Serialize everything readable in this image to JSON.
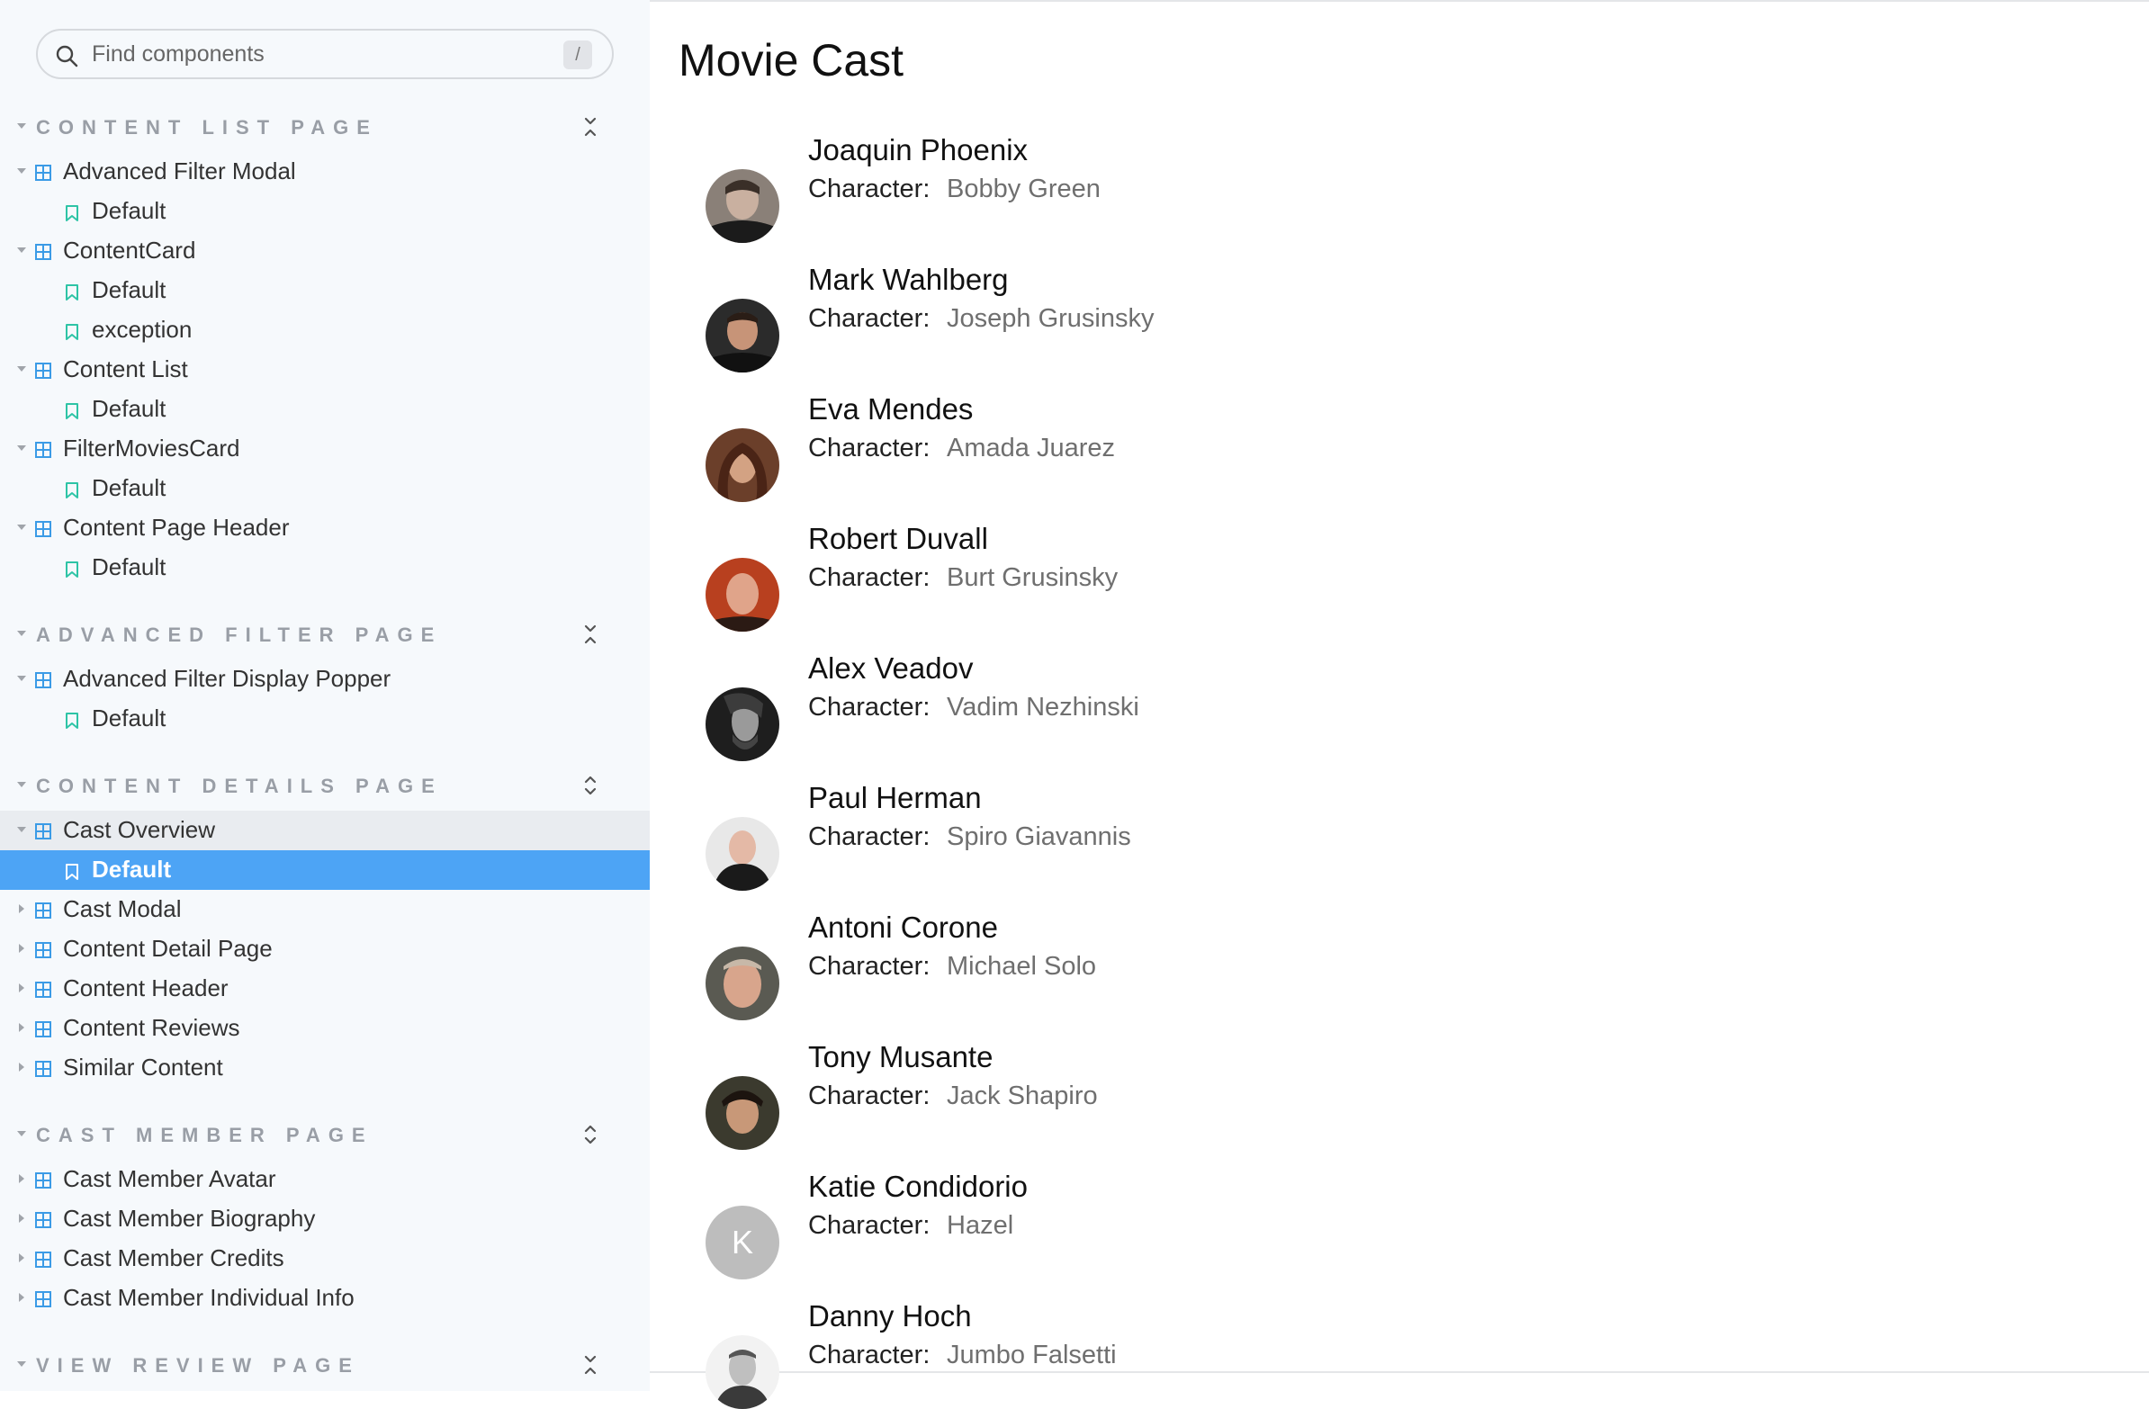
{
  "sidebar": {
    "search": {
      "placeholder": "Find components",
      "shortcut": "/"
    },
    "sections": [
      {
        "title": "CONTENT LIST PAGE",
        "components": [
          {
            "name": "Advanced Filter Modal",
            "stories": [
              "Default"
            ]
          },
          {
            "name": "ContentCard",
            "stories": [
              "Default",
              "exception"
            ]
          },
          {
            "name": "Content List",
            "stories": [
              "Default"
            ]
          },
          {
            "name": "FilterMoviesCard",
            "stories": [
              "Default"
            ]
          },
          {
            "name": "Content Page Header",
            "stories": [
              "Default"
            ]
          }
        ]
      },
      {
        "title": "ADVANCED FILTER PAGE",
        "components": [
          {
            "name": "Advanced Filter Display Popper",
            "stories": [
              "Default"
            ]
          }
        ]
      },
      {
        "title": "CONTENT DETAILS PAGE",
        "components": [
          {
            "name": "Cast Overview",
            "stories": [
              "Default"
            ]
          },
          {
            "name": "Cast Modal"
          },
          {
            "name": "Content Detail Page"
          },
          {
            "name": "Content Header"
          },
          {
            "name": "Content Reviews"
          },
          {
            "name": "Similar Content"
          }
        ]
      },
      {
        "title": "CAST MEMBER PAGE",
        "components": [
          {
            "name": "Cast Member Avatar"
          },
          {
            "name": "Cast Member Biography"
          },
          {
            "name": "Cast Member Credits"
          },
          {
            "name": "Cast Member Individual Info"
          }
        ]
      },
      {
        "title": "VIEW REVIEW PAGE"
      }
    ],
    "selected_story": "Default"
  },
  "main": {
    "title": "Movie Cast",
    "character_label": "Character:",
    "cast": [
      {
        "actor": "Joaquin Phoenix",
        "character": "Bobby Green"
      },
      {
        "actor": "Mark Wahlberg",
        "character": "Joseph Grusinsky"
      },
      {
        "actor": "Eva Mendes",
        "character": "Amada Juarez"
      },
      {
        "actor": "Robert Duvall",
        "character": "Burt Grusinsky"
      },
      {
        "actor": "Alex Veadov",
        "character": "Vadim Nezhinski"
      },
      {
        "actor": "Paul Herman",
        "character": "Spiro Giavannis"
      },
      {
        "actor": "Antoni Corone",
        "character": "Michael Solo"
      },
      {
        "actor": "Tony Musante",
        "character": "Jack Shapiro"
      },
      {
        "actor": "Katie Condidorio",
        "character": "Hazel",
        "initial": "K"
      },
      {
        "actor": "Danny Hoch",
        "character": "Jumbo Falsetti"
      }
    ]
  },
  "colors": {
    "accent": "#4da4f5",
    "component_icon": "#3b9be6",
    "story_icon": "#2ec4a6",
    "section_header": "#999ea6"
  }
}
